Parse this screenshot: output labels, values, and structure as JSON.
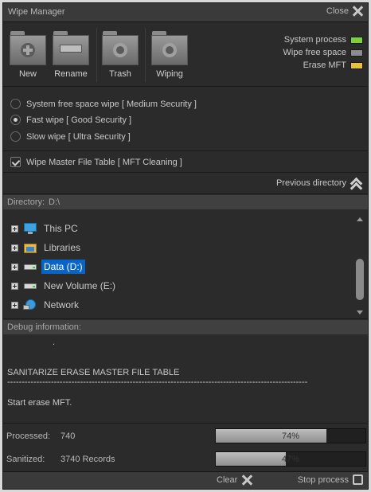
{
  "window": {
    "title": "Wipe Manager",
    "close_label": "Close"
  },
  "toolbar": {
    "buttons": [
      {
        "label": "New",
        "icon": "new-folder-icon"
      },
      {
        "label": "Rename",
        "icon": "rename-folder-icon"
      },
      {
        "label": "Trash",
        "icon": "trash-folder-icon"
      },
      {
        "label": "Wiping",
        "icon": "wiping-folder-icon"
      }
    ],
    "legend": [
      {
        "label": "System process",
        "color": "#7fd13b"
      },
      {
        "label": "Wipe free space",
        "color": "#8c8c8c"
      },
      {
        "label": "Erase MFT",
        "color": "#e8c33a"
      }
    ]
  },
  "wipe_options": [
    {
      "label": "System free space wipe [ Medium Security ]",
      "selected": false
    },
    {
      "label": "Fast wipe [ Good Security ]",
      "selected": true
    },
    {
      "label": "Slow wipe [ Ultra Security ]",
      "selected": false
    }
  ],
  "mft": {
    "label": "Wipe Master File Table [ MFT Cleaning ]",
    "checked": true
  },
  "navigation": {
    "previous_label": "Previous directory"
  },
  "directory": {
    "label": "Directory:",
    "value": "D:\\"
  },
  "tree": {
    "items": [
      {
        "label": "This PC",
        "icon": "pc-icon",
        "selected": false
      },
      {
        "label": "Libraries",
        "icon": "libraries-icon",
        "selected": false
      },
      {
        "label": "Data (D:)",
        "icon": "drive-icon",
        "selected": true
      },
      {
        "label": "New Volume (E:)",
        "icon": "drive-icon",
        "selected": false
      },
      {
        "label": "Network",
        "icon": "network-icon",
        "selected": false
      }
    ]
  },
  "debug": {
    "header": "Debug information:",
    "lines": [
      ".",
      "SANITARIZE ERASE MASTER FILE TABLE",
      "-------------------------------------------------------------------------------------------------------",
      "Start erase MFT."
    ]
  },
  "stats": {
    "processed": {
      "label": "Processed:",
      "value": "740",
      "percent": 74,
      "percent_label": "74%"
    },
    "sanitized": {
      "label": "Sanitized:",
      "value": "3740 Records",
      "percent": 47,
      "percent_label": "47%"
    }
  },
  "footer": {
    "clear_label": "Clear",
    "stop_label": "Stop process"
  }
}
